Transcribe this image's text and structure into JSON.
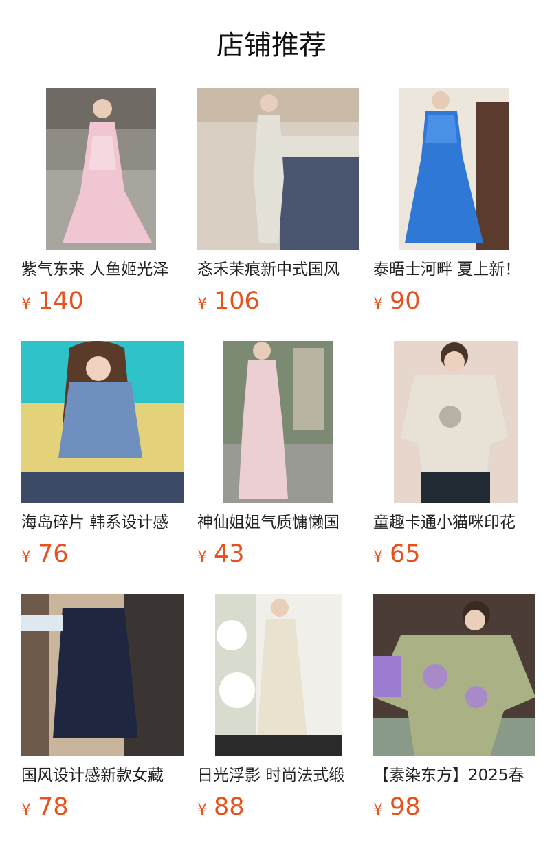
{
  "page": {
    "title": "店铺推荐"
  },
  "colors": {
    "price": "#e8501c",
    "text": "#222222"
  },
  "products": [
    {
      "name": "紫气东来 人鱼姬光泽",
      "currency": "¥",
      "price": "140",
      "image": "pink-satin-dress-photo"
    },
    {
      "name": "忞禾茉痕新中式国风",
      "currency": "¥",
      "price": "106",
      "image": "white-qipao-dress-photo"
    },
    {
      "name": "泰晤士河畔 夏上新！",
      "currency": "¥",
      "price": "90",
      "image": "blue-floral-dress-photo"
    },
    {
      "name": "海岛碎片 韩系设计感",
      "currency": "¥",
      "price": "76",
      "image": "denim-top-outfit-photo"
    },
    {
      "name": "神仙姐姐气质慵懒国",
      "currency": "¥",
      "price": "43",
      "image": "pink-chinese-style-set-photo"
    },
    {
      "name": "童趣卡通小猫咪印花",
      "currency": "¥",
      "price": "65",
      "image": "cat-print-tshirt-photo"
    },
    {
      "name": "国风设计感新款女藏",
      "currency": "¥",
      "price": "78",
      "image": "navy-knit-top-photo"
    },
    {
      "name": "日光浮影 时尚法式缎",
      "currency": "¥",
      "price": "88",
      "image": "white-satin-outfit-photo"
    },
    {
      "name": "【素染东方】2025春",
      "currency": "¥",
      "price": "98",
      "image": "purple-green-print-shirt-photo"
    }
  ]
}
